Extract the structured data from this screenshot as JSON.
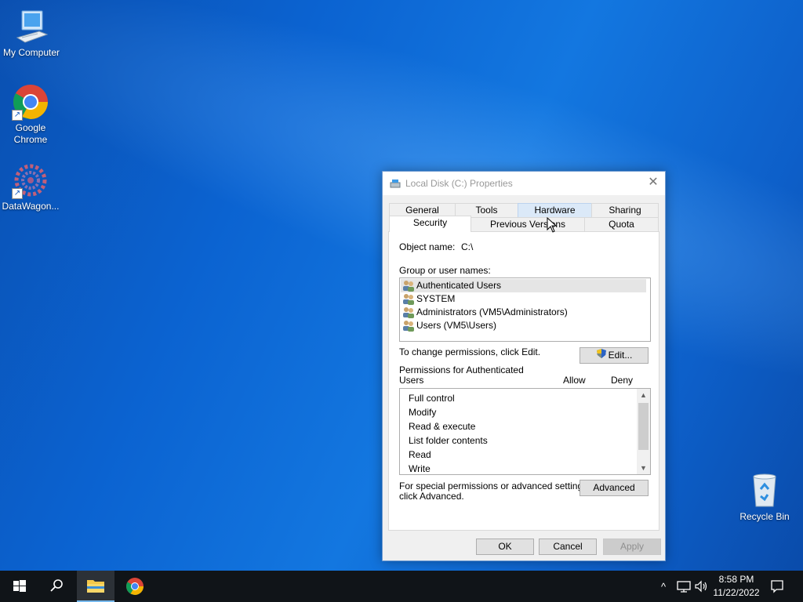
{
  "desktop": {
    "icons": [
      {
        "label": "My Computer",
        "icon": "computer-icon"
      },
      {
        "label": "Google Chrome",
        "icon": "chrome-icon"
      },
      {
        "label": "DataWagon...",
        "icon": "datawagon-icon"
      },
      {
        "label": "Recycle Bin",
        "icon": "recycle-bin-icon"
      }
    ]
  },
  "dialog": {
    "title": "Local Disk (C:) Properties",
    "close_glyph": "✕",
    "tabs_row1": [
      "General",
      "Tools",
      "Hardware",
      "Sharing"
    ],
    "tabs_row2": [
      "Security",
      "Previous Versions",
      "Quota"
    ],
    "active_tab": "Security",
    "hover_tab": "Hardware",
    "object_name_label": "Object name:",
    "object_name_value": "C:\\",
    "group_label": "Group or user names:",
    "users": [
      "Authenticated Users",
      "SYSTEM",
      "Administrators (VM5\\Administrators)",
      "Users (VM5\\Users)"
    ],
    "change_perm_text": "To change permissions, click Edit.",
    "edit_button": "Edit...",
    "permissions_for_line1": "Permissions for Authenticated",
    "permissions_for_line2": "Users",
    "allow_header": "Allow",
    "deny_header": "Deny",
    "permissions": [
      "Full control",
      "Modify",
      "Read & execute",
      "List folder contents",
      "Read",
      "Write"
    ],
    "special_text_line1": "For special permissions or advanced settings,",
    "special_text_line2": "click Advanced.",
    "advanced_button": "Advanced",
    "ok_button": "OK",
    "cancel_button": "Cancel",
    "apply_button": "Apply"
  },
  "taskbar": {
    "time": "8:58 PM",
    "date": "11/22/2022",
    "tray_chevron": "^"
  },
  "colors": {
    "accent": "#0b63d1",
    "taskbar": "#101418",
    "dialog_bg": "#f0f0f0"
  }
}
